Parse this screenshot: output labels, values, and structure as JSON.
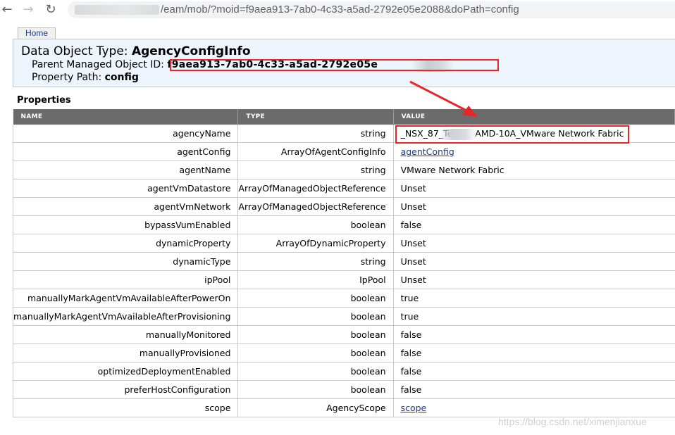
{
  "browser": {
    "url_path": "/eam/mob/?moid=f9aea913-7ab0-4c33-a5ad-2792e05e2088&doPath=config",
    "back_icon": "back-arrow-icon",
    "forward_icon": "forward-arrow-icon",
    "reload_icon": "reload-icon"
  },
  "nav": {
    "home_label": "Home"
  },
  "header": {
    "data_object_type_label": "Data Object Type: ",
    "data_object_type": "AgencyConfigInfo",
    "parent_moid_label": "Parent Managed Object ID: ",
    "parent_moid": "f9aea913-7ab0-4c33-a5ad-2792e05e",
    "property_path_label": "Property Path: ",
    "property_path": "config"
  },
  "properties": {
    "title": "Properties",
    "columns": [
      "NAME",
      "TYPE",
      "VALUE"
    ],
    "rows": [
      {
        "name": "agencyName",
        "type": "string",
        "value": "_NSX_87_Te",
        "value_suffix": "AMD-10A_VMware Network Fabric",
        "link": false
      },
      {
        "name": "agentConfig",
        "type": "ArrayOfAgentConfigInfo",
        "value": "agentConfig",
        "link": true
      },
      {
        "name": "agentName",
        "type": "string",
        "value": "VMware Network Fabric",
        "link": false
      },
      {
        "name": "agentVmDatastore",
        "type": "ArrayOfManagedObjectReference",
        "value": "Unset",
        "link": false
      },
      {
        "name": "agentVmNetwork",
        "type": "ArrayOfManagedObjectReference",
        "value": "Unset",
        "link": false
      },
      {
        "name": "bypassVumEnabled",
        "type": "boolean",
        "value": "false",
        "link": false
      },
      {
        "name": "dynamicProperty",
        "type": "ArrayOfDynamicProperty",
        "value": "Unset",
        "link": false
      },
      {
        "name": "dynamicType",
        "type": "string",
        "value": "Unset",
        "link": false
      },
      {
        "name": "ipPool",
        "type": "IpPool",
        "value": "Unset",
        "link": false
      },
      {
        "name": "manuallyMarkAgentVmAvailableAfterPowerOn",
        "type": "boolean",
        "value": "true",
        "link": false
      },
      {
        "name": "manuallyMarkAgentVmAvailableAfterProvisioning",
        "type": "boolean",
        "value": "true",
        "link": false
      },
      {
        "name": "manuallyMonitored",
        "type": "boolean",
        "value": "false",
        "link": false
      },
      {
        "name": "manuallyProvisioned",
        "type": "boolean",
        "value": "false",
        "link": false
      },
      {
        "name": "optimizedDeploymentEnabled",
        "type": "boolean",
        "value": "false",
        "link": false
      },
      {
        "name": "preferHostConfiguration",
        "type": "boolean",
        "value": "false",
        "link": false
      },
      {
        "name": "scope",
        "type": "AgencyScope",
        "value": "scope",
        "link": true
      }
    ]
  },
  "annotation": {
    "color": "#e8262a"
  },
  "watermark": "https://blog.csdn.net/ximenjianxue"
}
